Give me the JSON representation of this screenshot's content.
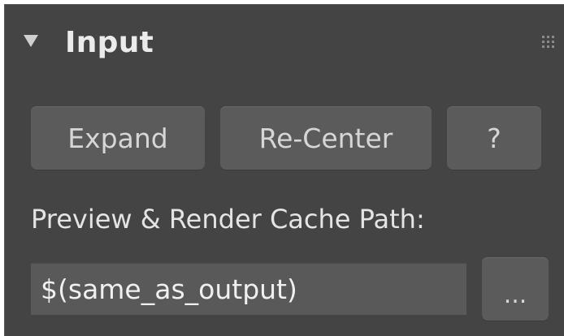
{
  "rollout": {
    "title": "Input",
    "collapse_icon": "triangle-down-icon",
    "grip_icon": "drag-grip-icon"
  },
  "buttons": {
    "expand_label": "Expand",
    "recenter_label": "Re-Center",
    "help_label": "?"
  },
  "cache_path": {
    "label": "Preview & Render Cache Path:",
    "value": "$(same_as_output)",
    "browse_label": "..."
  },
  "colors": {
    "panel_background": "#444444",
    "button_background": "#5b5b5b",
    "field_background": "#595959",
    "text": "#e6e6e6"
  }
}
